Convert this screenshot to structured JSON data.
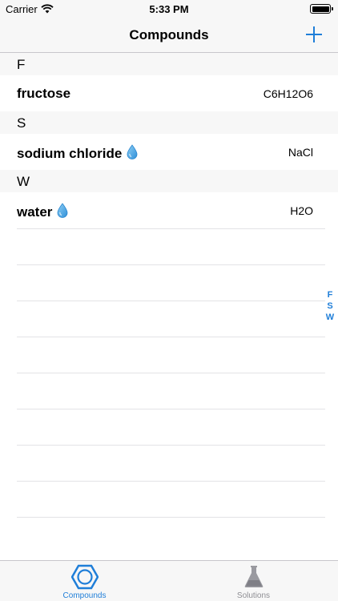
{
  "status_bar": {
    "carrier": "Carrier",
    "time": "5:33 PM"
  },
  "nav": {
    "title": "Compounds"
  },
  "sections": [
    {
      "header": "F",
      "items": [
        {
          "name": "fructose",
          "formula": "C6H12O6",
          "has_drop": false
        }
      ]
    },
    {
      "header": "S",
      "items": [
        {
          "name": "sodium chloride",
          "formula": "NaCl",
          "has_drop": true
        }
      ]
    },
    {
      "header": "W",
      "items": [
        {
          "name": "water",
          "formula": "H2O",
          "has_drop": true
        }
      ]
    }
  ],
  "index": [
    "F",
    "S",
    "W"
  ],
  "tabs": [
    {
      "label": "Compounds",
      "icon": "hexagon-icon",
      "active": true
    },
    {
      "label": "Solutions",
      "icon": "flask-icon",
      "active": false
    }
  ],
  "colors": {
    "accent": "#1f7ed8",
    "inactive": "#8e8e93",
    "bar_bg": "#f7f7f7"
  }
}
